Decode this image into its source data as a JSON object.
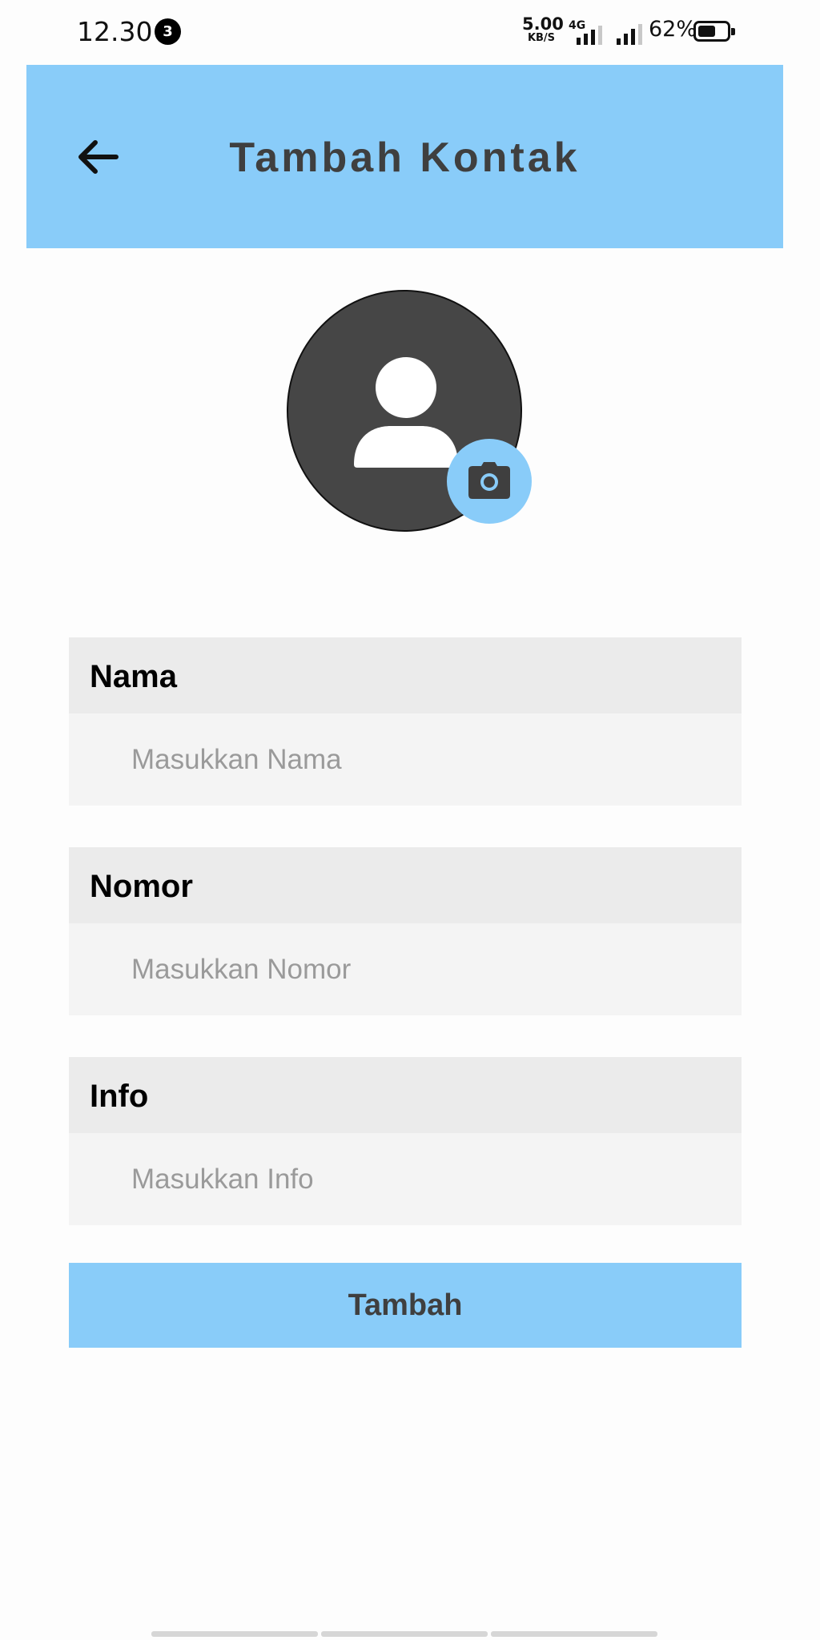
{
  "status_bar": {
    "time": "12.30",
    "notification_count": "3",
    "net_speed_value": "5.00",
    "net_speed_unit": "KB/S",
    "network_type": "4G",
    "battery_percent": "62%",
    "battery_level": 0.62
  },
  "app_bar": {
    "title": "Tambah Kontak",
    "back_icon": "arrow-left-icon",
    "background_color": "#89ccf9"
  },
  "avatar": {
    "icon": "person-icon",
    "camera_icon": "camera-icon",
    "avatar_color": "#464646"
  },
  "form": {
    "fields": [
      {
        "label": "Nama",
        "placeholder": "Masukkan Nama",
        "value": ""
      },
      {
        "label": "Nomor",
        "placeholder": "Masukkan Nomor",
        "value": ""
      },
      {
        "label": "Info",
        "placeholder": "Masukkan Info",
        "value": ""
      }
    ],
    "submit_label": "Tambah"
  }
}
